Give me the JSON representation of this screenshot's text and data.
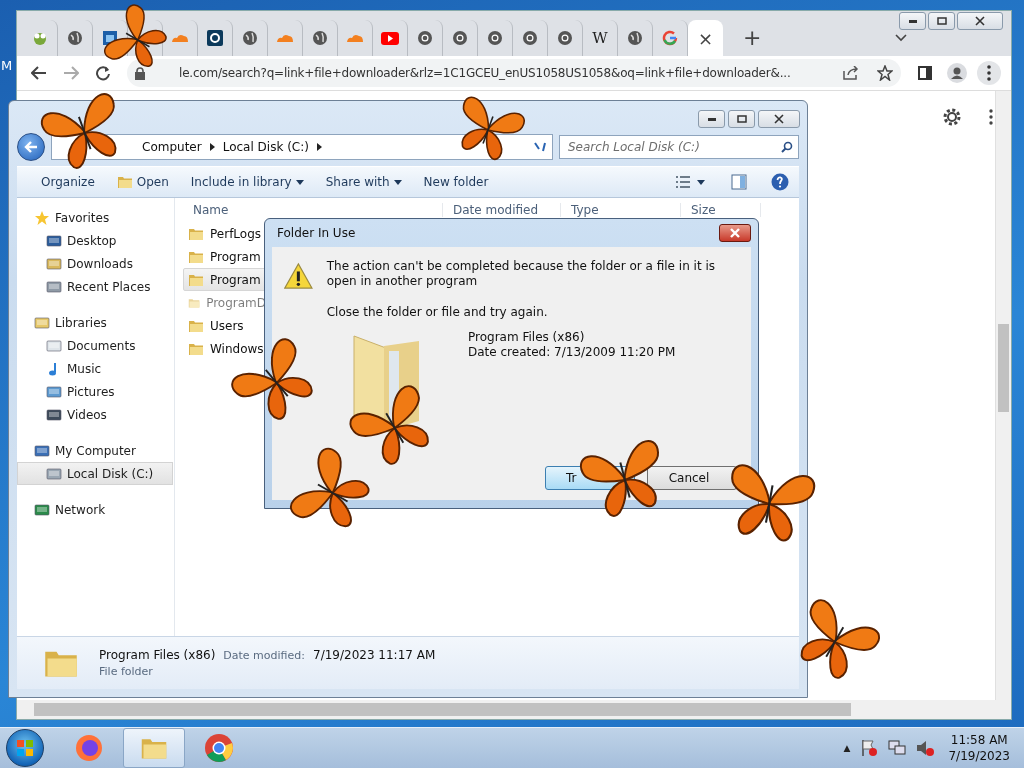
{
  "desktop": {
    "label": "M"
  },
  "browser": {
    "tabs": [
      {
        "kind": "frog",
        "selected": false
      },
      {
        "kind": "globe",
        "selected": false
      },
      {
        "kind": "tile",
        "selected": false
      },
      {
        "kind": "blank",
        "selected": false
      },
      {
        "kind": "cloud",
        "selected": false
      },
      {
        "kind": "ring",
        "selected": false
      },
      {
        "kind": "globe",
        "selected": false
      },
      {
        "kind": "cloud",
        "selected": false
      },
      {
        "kind": "globe",
        "selected": false
      },
      {
        "kind": "cloud",
        "selected": false
      },
      {
        "kind": "play",
        "selected": false
      },
      {
        "kind": "chrome",
        "selected": false
      },
      {
        "kind": "chrome",
        "selected": false
      },
      {
        "kind": "chrome",
        "selected": false
      },
      {
        "kind": "chrome",
        "selected": false
      },
      {
        "kind": "chrome",
        "selected": false
      },
      {
        "kind": "letter",
        "label": "W",
        "selected": false
      },
      {
        "kind": "globe",
        "selected": false
      },
      {
        "kind": "google",
        "selected": false
      },
      {
        "kind": "blank",
        "selected": true,
        "close": "×"
      }
    ],
    "new_tab": "+",
    "address": "le.com/search?q=link+file+downloader&rlz=1C1GCEU_enUS1058US1058&oq=link+file+downloader&..."
  },
  "explorer": {
    "breadcrumb": [
      "Computer",
      "Local Disk (C:)"
    ],
    "search": {
      "placeholder": "Search Local Disk (C:)"
    },
    "toolbar": [
      {
        "label": "Organize",
        "kind": "plain"
      },
      {
        "label": "Open",
        "kind": "open"
      },
      {
        "label": "Include in library",
        "kind": "menu"
      },
      {
        "label": "Share with",
        "kind": "menu"
      },
      {
        "label": "New folder",
        "kind": "plain"
      }
    ],
    "sidebar": [
      {
        "label": "Favorites",
        "kind": "star",
        "selected": false,
        "children": [
          {
            "label": "Desktop",
            "kind": "desktop",
            "selected": false
          },
          {
            "label": "Downloads",
            "kind": "downloads",
            "selected": false
          },
          {
            "label": "Recent Places",
            "kind": "recent",
            "selected": false
          }
        ]
      },
      {
        "label": "Libraries",
        "kind": "library",
        "selected": false,
        "children": [
          {
            "label": "Documents",
            "kind": "document",
            "selected": false
          },
          {
            "label": "Music",
            "kind": "music",
            "selected": false
          },
          {
            "label": "Pictures",
            "kind": "picture",
            "selected": false
          },
          {
            "label": "Videos",
            "kind": "video",
            "selected": false
          }
        ]
      },
      {
        "label": "My Computer",
        "kind": "computer",
        "selected": false,
        "children": [
          {
            "label": "Local Disk (C:)",
            "kind": "disk",
            "selected": true
          }
        ]
      },
      {
        "label": "Network",
        "kind": "network",
        "selected": false
      }
    ],
    "columns": [
      "Name",
      "Date modified",
      "Type",
      "Size"
    ],
    "files": [
      {
        "name": "PerfLogs",
        "selected": false,
        "hidden": false
      },
      {
        "name": "Program",
        "selected": false,
        "hidden": false
      },
      {
        "name": "Program",
        "selected": true,
        "hidden": false
      },
      {
        "name": "ProgramD",
        "selected": false,
        "hidden": true
      },
      {
        "name": "Users",
        "selected": false,
        "hidden": false
      },
      {
        "name": "Windows",
        "selected": false,
        "hidden": false
      }
    ],
    "details": {
      "name": "Program Files (x86)",
      "date_label": "Date modified:",
      "date": "7/19/2023 11:17 AM",
      "type": "File folder"
    }
  },
  "dialog": {
    "title": "Folder In Use",
    "message": "The action can't be completed because the folder or a file in it is open in another program",
    "hint": "Close the folder or file and try again.",
    "item_name": "Program Files (x86)",
    "item_date": "Date created: 7/13/2009 11:20 PM",
    "buttons": [
      {
        "label": "Tr",
        "default": true
      },
      {
        "label": "Cancel",
        "default": false
      }
    ]
  },
  "taskbar": {
    "apps": [
      {
        "kind": "firefox",
        "active": false
      },
      {
        "kind": "explorer",
        "active": true
      },
      {
        "kind": "chrome",
        "active": false
      }
    ],
    "tray_caret": "▲",
    "time": "11:58 AM",
    "date": "7/19/2023"
  }
}
